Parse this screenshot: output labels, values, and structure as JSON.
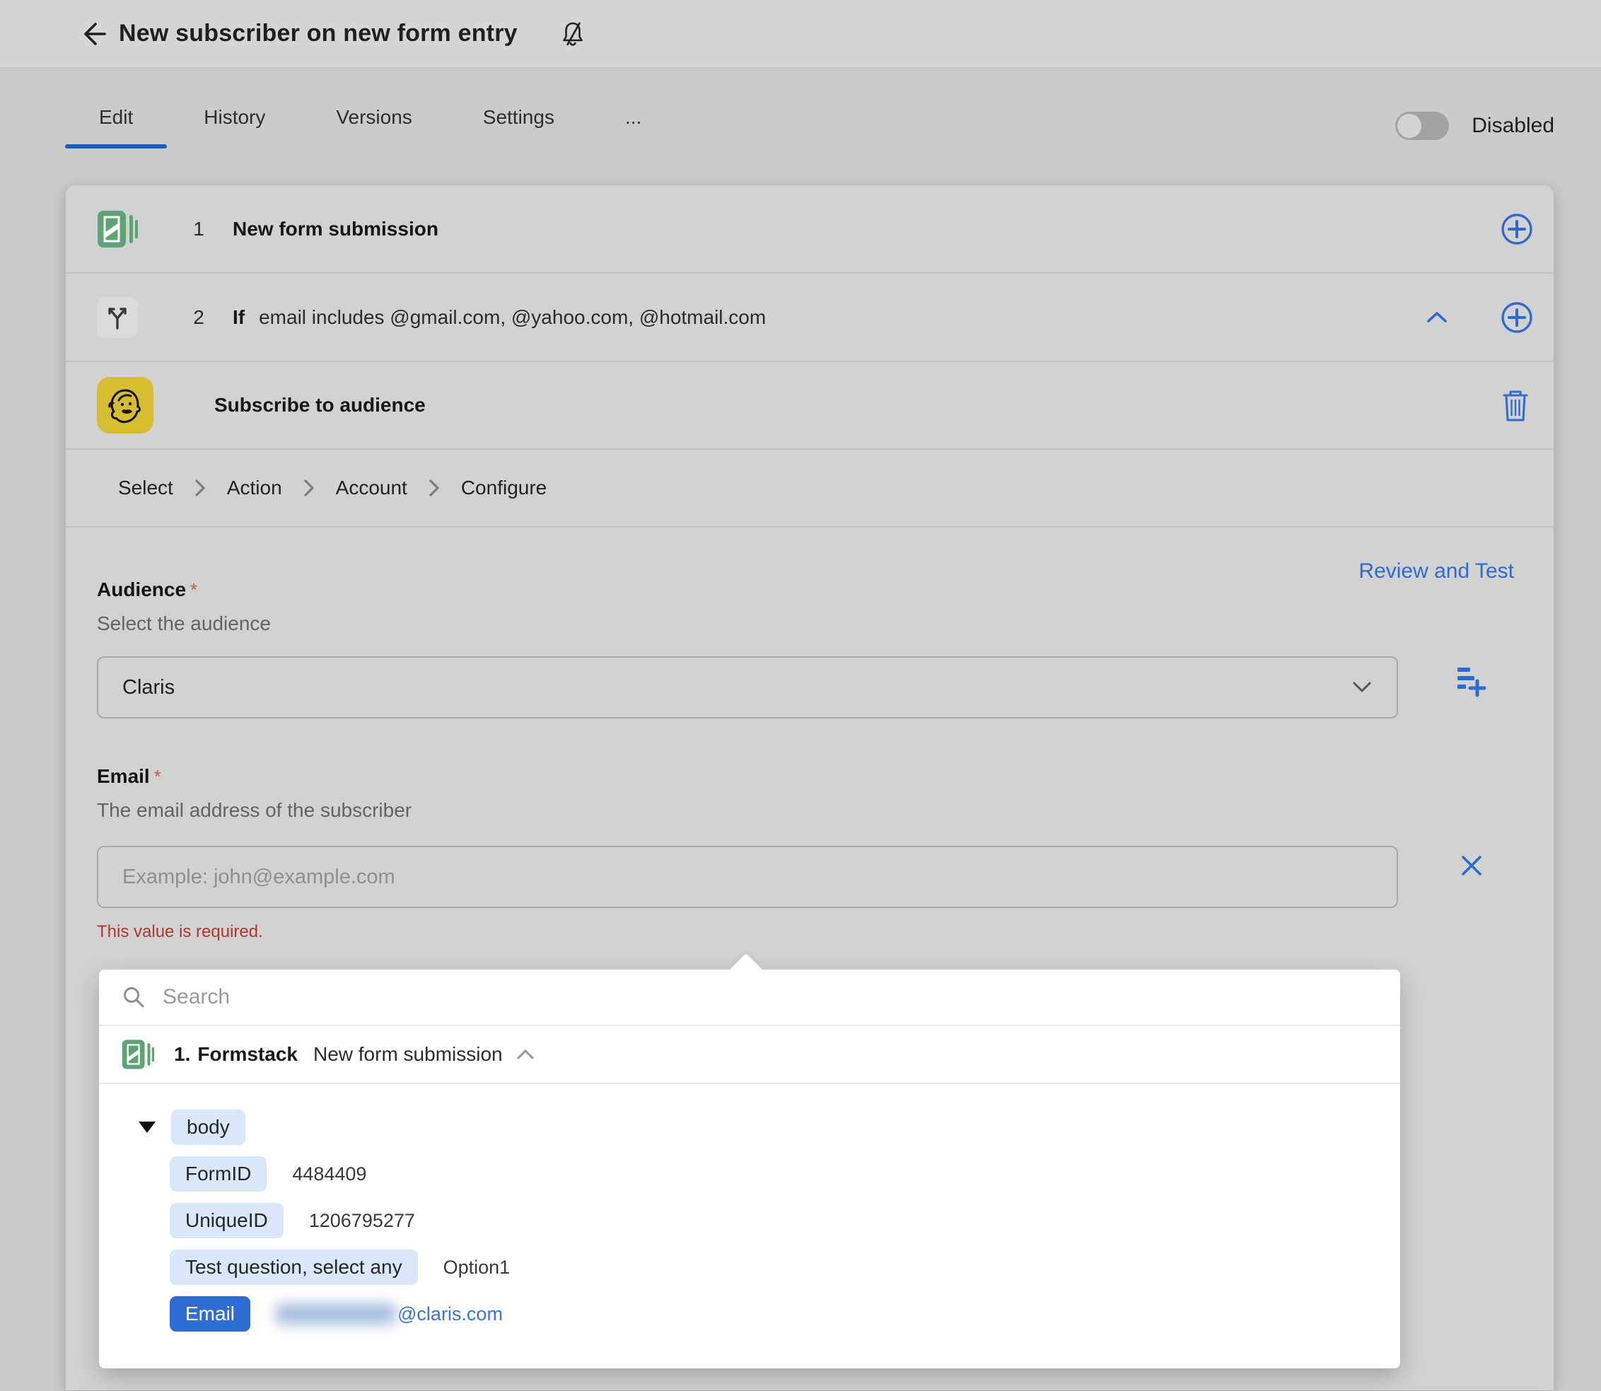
{
  "header": {
    "title": "New subscriber on new form entry"
  },
  "tabs": {
    "items": [
      {
        "label": "Edit",
        "active": true
      },
      {
        "label": "History",
        "active": false
      },
      {
        "label": "Versions",
        "active": false
      },
      {
        "label": "Settings",
        "active": false
      },
      {
        "label": "...",
        "active": false
      }
    ],
    "toggle_label": "Disabled",
    "toggle_state": "off"
  },
  "flow": {
    "steps": [
      {
        "index": "1",
        "app": "formstack",
        "title": "New form submission"
      },
      {
        "index": "2",
        "keyword": "If",
        "condition": "email includes @gmail.com, @yahoo.com, @hotmail.com"
      }
    ],
    "action": {
      "app": "mailchimp",
      "title": "Subscribe to audience"
    }
  },
  "breadcrumb": {
    "items": [
      "Select",
      "Action",
      "Account",
      "Configure"
    ]
  },
  "configure": {
    "review_link": "Review and Test",
    "audience": {
      "label": "Audience",
      "required_mark": "*",
      "helper": "Select the audience",
      "value": "Claris"
    },
    "email": {
      "label": "Email",
      "required_mark": "*",
      "helper": "The email address of the subscriber",
      "placeholder": "Example: john@example.com",
      "value": "",
      "error": "This value is required."
    }
  },
  "picker": {
    "search_placeholder": "Search",
    "source": {
      "step_number": "1.",
      "app_name": "Formstack",
      "event": "New form submission"
    },
    "tree": {
      "root": "body",
      "fields": [
        {
          "key": "FormID",
          "value": "4484409"
        },
        {
          "key": "UniqueID",
          "value": "1206795277"
        },
        {
          "key": "Test question, select any",
          "value": "Option1"
        },
        {
          "key": "Email",
          "value_redacted": true,
          "value_suffix": "@claris.com"
        }
      ]
    }
  },
  "icons": {
    "back": "back-arrow-icon",
    "bell": "notifications-off-icon",
    "branch": "branch-if-icon",
    "formstack": "formstack-icon",
    "mailchimp": "mailchimp-icon",
    "plus": "add-step-icon",
    "collapse": "chevron-up-icon",
    "trash": "trash-icon",
    "select_chevron": "chevron-down-icon",
    "list_add": "insert-list-item-icon",
    "clear": "clear-x-icon",
    "search": "search-icon",
    "tree_expand": "triangle-down-icon"
  },
  "colors": {
    "accent_blue": "#2e6bd1",
    "tab_underline": "#1d5cbf",
    "error_red": "#a8392c",
    "formstack_green": "#5da374",
    "mailchimp_yellow": "#d6be30",
    "chip_bg": "#d9e7f8",
    "email_chip_bg": "#2f6cd4",
    "page_bg": "#cbcbcb",
    "card_bg": "#d2d2d2",
    "panel_bg": "#ffffff"
  }
}
